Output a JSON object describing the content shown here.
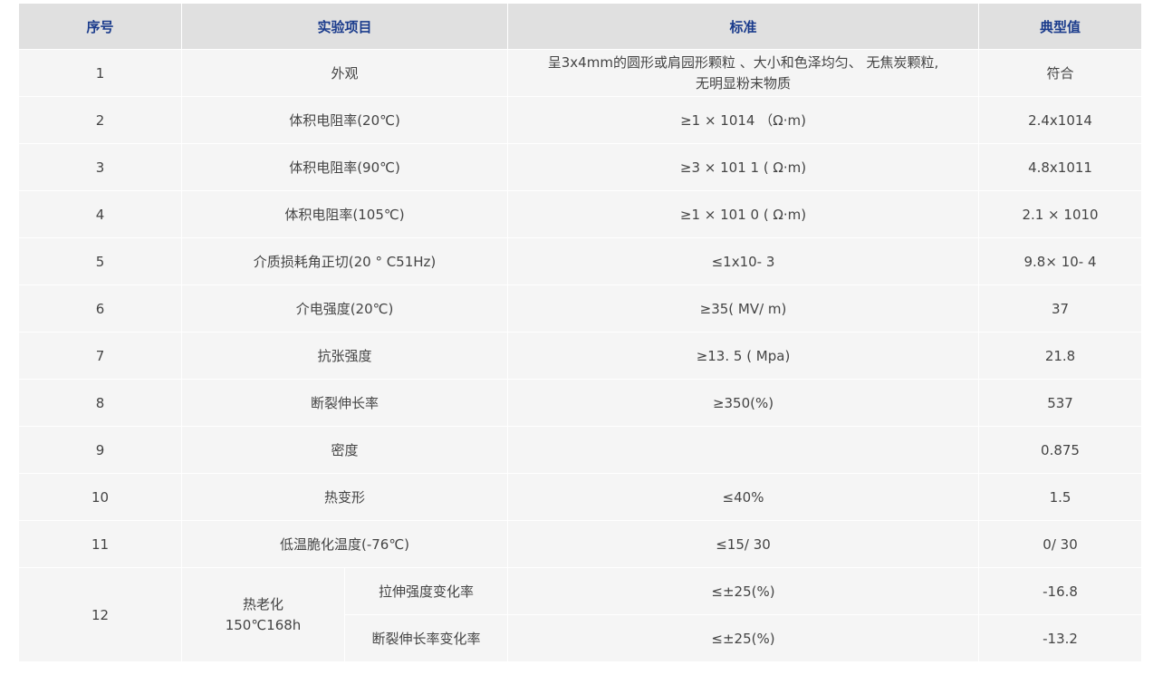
{
  "table": {
    "headers": {
      "no": "序号",
      "item": "实验项目",
      "standard": "标准",
      "typical": "典型值"
    },
    "rows": [
      {
        "no": "1",
        "item": "外观",
        "standard": "呈3x4mm的圆形或肩园形颗粒 、大小和色泽均匀、 无焦炭颗粒,\n无明显粉末物质",
        "typical": "符合"
      },
      {
        "no": "2",
        "item": "体积电阻率(20℃)",
        "standard": "≥1 × 1014 （Ω·m)",
        "typical": "2.4x1014"
      },
      {
        "no": "3",
        "item": "体积电阻率(90℃)",
        "standard": "≥3 × 101 1 ( Ω·m)",
        "typical": "4.8x1011"
      },
      {
        "no": "4",
        "item": "体积电阻率(105℃)",
        "standard": "≥1 × 101 0 ( Ω·m)",
        "typical": "2.1 × 1010"
      },
      {
        "no": "5",
        "item": "介质损耗角正切(20 ° C51Hz)",
        "standard": "≤1x10- 3",
        "typical": "9.8× 10- 4"
      },
      {
        "no": "6",
        "item": "介电强度(20℃)",
        "standard": "≥35( MV/ m)",
        "typical": "37"
      },
      {
        "no": "7",
        "item": "抗张强度",
        "standard": "≥13. 5 ( Mpa)",
        "typical": "21.8"
      },
      {
        "no": "8",
        "item": "断裂伸长率",
        "standard": "≥350(%)",
        "typical": "537"
      },
      {
        "no": "9",
        "item": "密度",
        "standard": "",
        "typical": "0.875"
      },
      {
        "no": "10",
        "item": "热变形",
        "standard": "≤40%",
        "typical": "1.5"
      },
      {
        "no": "11",
        "item": "低温脆化温度(-76℃)",
        "standard": "≤15/ 30",
        "typical": "0/ 30"
      }
    ],
    "row12": {
      "no": "12",
      "group": "热老化\n150℃168h",
      "subrows": [
        {
          "item": "拉伸强度变化率",
          "standard": "≤±25(%)",
          "typical": "-16.8"
        },
        {
          "item": "断裂伸长率变化率",
          "standard": "≤±25(%)",
          "typical": "-13.2"
        }
      ]
    }
  }
}
